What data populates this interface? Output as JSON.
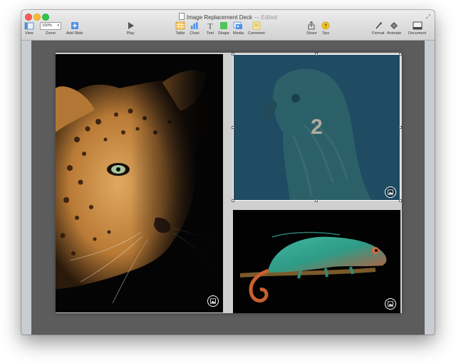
{
  "window": {
    "title": "Image Replacement Deck",
    "title_suffix": "— Edited"
  },
  "toolbar": {
    "view": "View",
    "zoom_value": "100%",
    "zoom": "Zoom",
    "add_slide": "Add Slide",
    "play": "Play",
    "table": "Table",
    "chart": "Chart",
    "text": "Text",
    "shape": "Shape",
    "media": "Media",
    "comment": "Comment",
    "share": "Share",
    "tips": "Tips",
    "format": "Format",
    "animate": "Animate",
    "document": "Document"
  },
  "slide": {
    "placeholder_number": "2"
  },
  "colors": {
    "close": "#fc5e57",
    "minimize": "#fdbc2e",
    "maximize": "#33c748",
    "parrot_overlay": "#1f4b63"
  }
}
